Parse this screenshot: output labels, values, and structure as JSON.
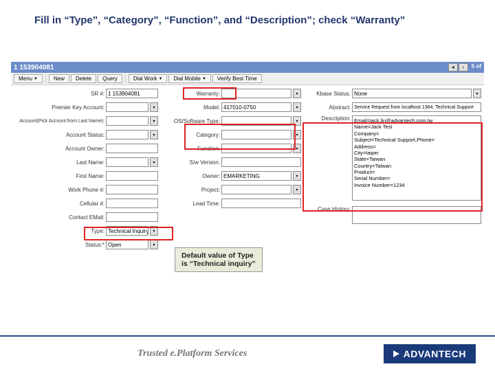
{
  "slide": {
    "title": "Fill in “Type”, “Category”, “Function”, and “Description”; check “Warranty”"
  },
  "titlebar": {
    "record_id": "1 153904081",
    "page_info": "5 of"
  },
  "menubar": {
    "menu": "Menu",
    "new": "New",
    "delete": "Delete",
    "query": "Query",
    "dial_work": "Dial Work",
    "dial_mobile": "Dial Mobile",
    "verify": "Verify Best Time"
  },
  "col1": {
    "sr_lbl": "SR #:",
    "sr_val": "1 153904081",
    "premier_lbl": "Premier Key Account:",
    "account_pick_lbl": "Account(Pick Account from Last Name):",
    "account_status_lbl": "Account Status:",
    "account_owner_lbl": "Account Owner:",
    "last_name_lbl": "Last Name:",
    "first_name_lbl": "First Name:",
    "work_phone_lbl": "Work Phone #:",
    "cellular_lbl": "Cellular #:",
    "contact_email_lbl": "Contact EMail:",
    "type_lbl": "Type:",
    "type_val": "Technical Inquiry",
    "status_lbl": "Status:*",
    "status_val": "Open"
  },
  "col2": {
    "warranty_lbl": "Warranty:",
    "model_lbl": "Model:",
    "model_val": "417010-0750",
    "ossw_lbl": "OS/Software Type:",
    "category_lbl": "Category:",
    "function_lbl": "Function:",
    "sw_ver_lbl": "S/w Version:",
    "owner_lbl": "Owner:",
    "owner_val": "EMARKETING",
    "project_lbl": "Project:",
    "lead_time_lbl": "Lead Time:"
  },
  "col3": {
    "kbase_lbl": "Kbase Status:",
    "kbase_val": "None",
    "abstract_lbl": "Abstract:",
    "abstract_val": "Service Request from localhost 1364, Technical Support",
    "desc_lbl": "Description:",
    "desc_lines": "Email=jack.lin@advantech.com.tw\nName=Jack Test\nCompany=\nSubject=Technical Support,Phone=\nAddress=\nCity=taipei\nState=Taiwan\nCountry=Taiwan\nProduct=\nSerial Number=\nInvoice Number=1234",
    "case_hist_lbl": "Case History:"
  },
  "callout": {
    "line1": "Default value of Type",
    "line2": "is “Technical inquiry”"
  },
  "footer": {
    "tagline": "Trusted e.Platform Services",
    "brand": "ADVANTECH"
  }
}
